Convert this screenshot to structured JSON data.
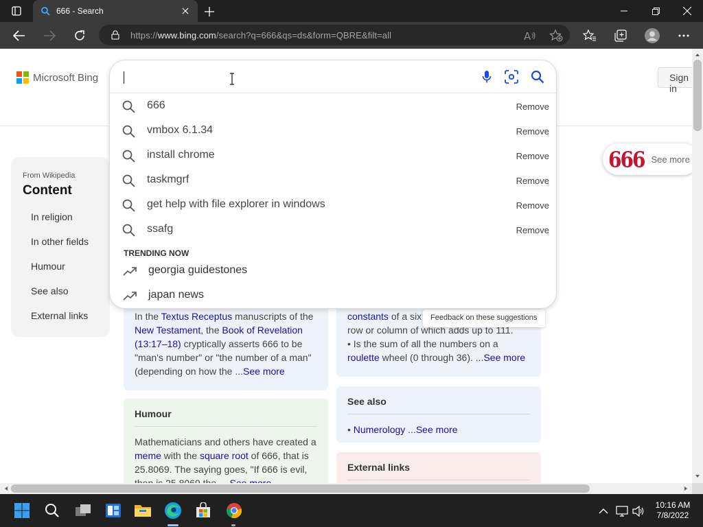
{
  "browser": {
    "tab_title": "666 - Search",
    "url_prefix": "https://",
    "url_domain": "www.bing.com",
    "url_path": "/search?q=666&qs=ds&form=QBRE&filt=all"
  },
  "bing": {
    "logo_text": "Microsoft Bing",
    "signin_label": "Sign in",
    "search": {
      "value": "",
      "suggestions": [
        {
          "text": "666",
          "remove": "Remove"
        },
        {
          "text": "vmbox 6.1.34",
          "remove": "Remove"
        },
        {
          "text": "install chrome",
          "remove": "Remove"
        },
        {
          "text": "taskmgrf",
          "remove": "Remove"
        },
        {
          "text": "get help with file explorer in windows",
          "remove": "Remove"
        },
        {
          "text": "ssafg",
          "remove": "Remove"
        }
      ],
      "trending_header": "TRENDING NOW",
      "trending": [
        "georgia guidestones",
        "japan news"
      ],
      "feedback": "Feedback on these suggestions"
    }
  },
  "toc": {
    "source": "From Wikipedia",
    "title": "Content",
    "items": [
      "In religion",
      "In other fields",
      "Humour",
      "See also",
      "External links"
    ]
  },
  "sidecard": {
    "number": "666",
    "see_more": "See more"
  },
  "cards": {
    "religion": {
      "t1": "In the ",
      "l1": "Textus Receptus",
      "t2": " manuscripts of the ",
      "l2": "New Testament",
      "t3": ", the ",
      "l3": "Book of Revelation",
      "l4": "(13:17–18)",
      "t4": " cryptically asserts 666 to be \"man's number\" or \"the number of a man\" (depending on how the ...",
      "more": "See more"
    },
    "other": {
      "l1": "constants",
      "t1": " of a six",
      "t2": "row or column of which adds up to 111.",
      "t3": "• Is the sum of all the numbers on a ",
      "l2": "roulette",
      "t4": " wheel (0 through 36).  ...",
      "more": "See more"
    },
    "humour": {
      "heading": "Humour",
      "t1": "Mathematicians and others have created a ",
      "l1": "meme",
      "t2": " with the ",
      "l2": "square root",
      "t3": " of 666, that is 25.8069. The saying goes, \"If 666 is evil, then is 25.8069 the ... ",
      "more": "See more"
    },
    "see_also": {
      "heading": "See also",
      "bullet": "• ",
      "link": "Numerology",
      "t1": " ...",
      "more": "See more"
    },
    "external": {
      "heading": "External links"
    }
  },
  "taskbar": {
    "time": "10:16 AM",
    "date": "7/8/2022"
  },
  "colors": {
    "bing_blue": "#174ae4",
    "link": "#1a0dab",
    "brand_red": "#c31431"
  }
}
